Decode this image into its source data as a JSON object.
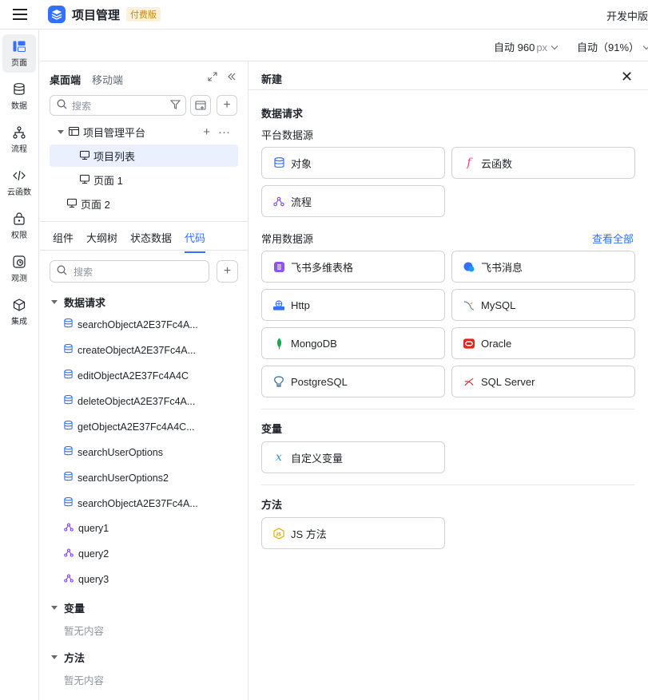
{
  "app": {
    "title": "项目管理",
    "badge": "付费版",
    "mode": "开发中版"
  },
  "rail": [
    {
      "label": "页面",
      "icon": "page-icon",
      "active": true
    },
    {
      "label": "数据",
      "icon": "database-icon"
    },
    {
      "label": "流程",
      "icon": "flow-icon"
    },
    {
      "label": "云函数",
      "icon": "code-icon"
    },
    {
      "label": "权限",
      "icon": "lock-icon"
    },
    {
      "label": "观测",
      "icon": "observe-icon"
    },
    {
      "label": "集成",
      "icon": "integration-icon"
    }
  ],
  "toolbar": {
    "width_value": "自动 960",
    "width_unit": "px",
    "zoom": "自动（91%）"
  },
  "mid": {
    "tab_desktop": "桌面端",
    "tab_mobile": "移动端",
    "search_placeholder": "搜索",
    "tree": [
      {
        "label": "项目管理平台"
      },
      {
        "label": "项目列表"
      },
      {
        "label": "页面 1"
      },
      {
        "label": "页面 2"
      }
    ],
    "tabs": [
      "组件",
      "大纲树",
      "状态数据",
      "代码"
    ],
    "code_search_placeholder": "搜索",
    "sections": {
      "requests": "数据请求",
      "variables": "变量",
      "methods": "方法"
    },
    "requests": [
      "searchObjectA2E37Fc4A...",
      "createObjectA2E37Fc4A...",
      "editObjectA2E37Fc4A4C",
      "deleteObjectA2E37Fc4A...",
      "getObjectA2E37Fc4A4C...",
      "searchUserOptions",
      "searchUserOptions2",
      "searchObjectA2E37Fc4A...",
      "query1",
      "query2",
      "query3"
    ],
    "empty_text": "暂无内容"
  },
  "right": {
    "title": "新建",
    "section_request": "数据请求",
    "platform_sources": "平台数据源",
    "platform": [
      "对象",
      "云函数",
      "流程"
    ],
    "common_sources": "常用数据源",
    "view_all": "查看全部",
    "common": [
      "飞书多维表格",
      "飞书消息",
      "Http",
      "MySQL",
      "MongoDB",
      "Oracle",
      "PostgreSQL",
      "SQL Server"
    ],
    "section_variable": "变量",
    "variable": [
      "自定义变量"
    ],
    "section_method": "方法",
    "method": [
      "JS 方法"
    ]
  },
  "colors": {
    "accent": "#3370ff",
    "border": "#d0d3d6",
    "selected_bg": "#eaf0fe"
  }
}
